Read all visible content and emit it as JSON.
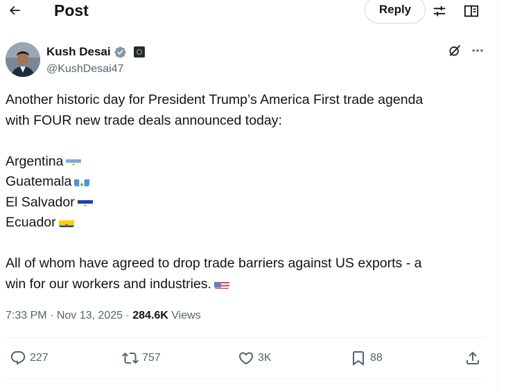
{
  "header": {
    "title": "Post",
    "reply_label": "Reply",
    "icons": [
      "back-arrow-icon",
      "sliders-icon",
      "reader-icon"
    ]
  },
  "author": {
    "name": "Kush Desai",
    "handle": "@KushDesai47",
    "verified": true,
    "icons": [
      "verified-badge-icon",
      "affiliate-badge-icon",
      "grok-icon",
      "more-icon"
    ]
  },
  "tweet": {
    "intro_line1": "Another historic day for President Trump’s America First trade agenda",
    "intro_line2": "with FOUR new trade deals announced today:",
    "countries": [
      {
        "name": "Argentina",
        "flag": "flag-argentina"
      },
      {
        "name": "Guatemala",
        "flag": "flag-guatemala"
      },
      {
        "name": "El Salvador",
        "flag": "flag-el-salvador"
      },
      {
        "name": "Ecuador",
        "flag": "flag-ecuador"
      }
    ],
    "outro_line1": "All of whom have agreed to drop trade barriers against US exports - a",
    "outro_line2": "win for our workers and industries.",
    "outro_flag": "flag-usa"
  },
  "meta": {
    "time": "7:33 PM",
    "sep": "·",
    "date": "Nov 13, 2025",
    "views_count": "284.6K",
    "views_label": "Views"
  },
  "actions": {
    "replies": "227",
    "reposts": "757",
    "likes": "3K",
    "bookmarks": "88"
  },
  "colors": {
    "text": "#0f1419",
    "secondary": "#536471",
    "border": "#cfd9de",
    "divider": "#eff3f4",
    "verified": "#829aab"
  }
}
